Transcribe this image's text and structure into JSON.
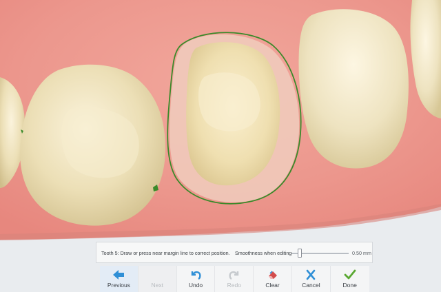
{
  "hint": {
    "instruction": "Tooth 5: Draw or press near margin line to correct position.",
    "smoothness_label": "Smoothness when editing",
    "smoothness_value": "0.50 mm",
    "smoothness_fraction": 0.15
  },
  "toolbar": {
    "previous": "Previous",
    "next": "Next",
    "undo": "Undo",
    "redo": "Redo",
    "clear": "Clear",
    "cancel": "Cancel",
    "done": "Done"
  },
  "icons": {
    "previous": "arrow-left-icon",
    "next": "arrow-right-icon",
    "undo": "undo-icon",
    "redo": "redo-icon",
    "clear": "eraser-icon",
    "cancel": "x-icon",
    "done": "checkmark-icon"
  },
  "colors": {
    "accent": "#2f8fd6",
    "margin_line": "#3a8a2a",
    "done": "#5aa832",
    "cancel": "#2f8fd6"
  }
}
